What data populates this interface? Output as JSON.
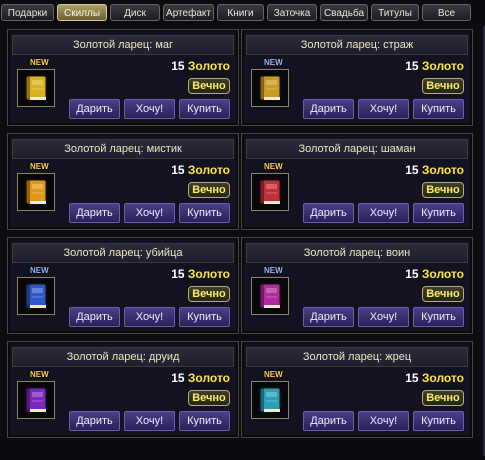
{
  "tabs": [
    {
      "label": "Подарки",
      "active": false
    },
    {
      "label": "Скиллы",
      "active": true
    },
    {
      "label": "Диск",
      "active": false
    },
    {
      "label": "Артефакт",
      "active": false
    },
    {
      "label": "Книги",
      "active": false
    },
    {
      "label": "Заточка",
      "active": false
    },
    {
      "label": "Свадьба",
      "active": false
    },
    {
      "label": "Титулы",
      "active": false
    },
    {
      "label": "Все",
      "active": false
    }
  ],
  "items": [
    {
      "title": "Золотой ларец: маг",
      "price": "15",
      "currency": "Золото",
      "duration": "Вечно",
      "badge": "NEW",
      "badge_color": "gold",
      "book_color": "#d8b020"
    },
    {
      "title": "Золотой ларец: страж",
      "price": "15",
      "currency": "Золото",
      "duration": "Вечно",
      "badge": "NEW",
      "badge_color": "blue",
      "book_color": "#c89a20"
    },
    {
      "title": "Золотой ларец: мистик",
      "price": "15",
      "currency": "Золото",
      "duration": "Вечно",
      "badge": "NEW",
      "badge_color": "gold",
      "book_color": "#e09818"
    },
    {
      "title": "Золотой ларец: шаман",
      "price": "15",
      "currency": "Золото",
      "duration": "Вечно",
      "badge": "NEW",
      "badge_color": "gold",
      "book_color": "#c0303a"
    },
    {
      "title": "Золотой ларец: убийца",
      "price": "15",
      "currency": "Золото",
      "duration": "Вечно",
      "badge": "NEW",
      "badge_color": "blue",
      "book_color": "#2c58c8"
    },
    {
      "title": "Золотой ларец: воин",
      "price": "15",
      "currency": "Золото",
      "duration": "Вечно",
      "badge": "NEW",
      "badge_color": "blue",
      "book_color": "#b02c9c"
    },
    {
      "title": "Золотой ларец: друид",
      "price": "15",
      "currency": "Золото",
      "duration": "Вечно",
      "badge": "NEW",
      "badge_color": "gold",
      "book_color": "#7a28c0"
    },
    {
      "title": "Золотой ларец: жрец",
      "price": "15",
      "currency": "Золото",
      "duration": "Вечно",
      "badge": "NEW",
      "badge_color": "gold",
      "book_color": "#28a0b8"
    }
  ],
  "buttons": {
    "gift": "Дарить",
    "want": "Хочу!",
    "buy": "Купить"
  }
}
